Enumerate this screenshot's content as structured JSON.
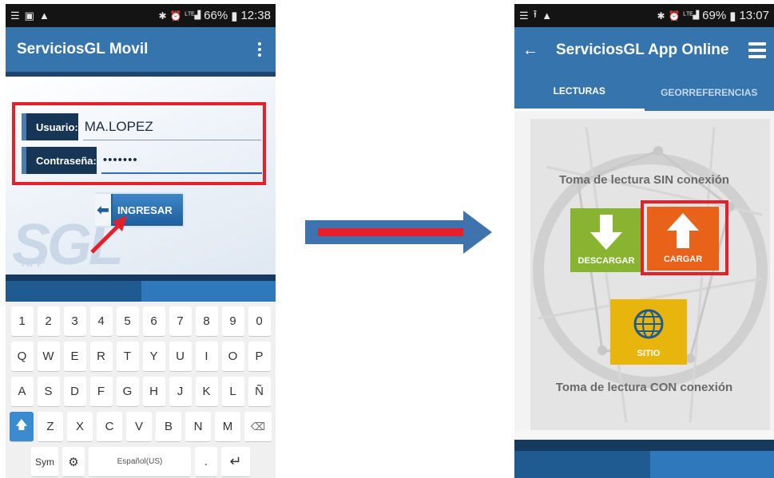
{
  "left_phone": {
    "status": {
      "battery": "66%",
      "time": "12:38"
    },
    "app_title": "ServiciosGL Movil",
    "login": {
      "user_label": "Usuario:",
      "user_value": "MA.LOPEZ",
      "password_label": "Contraseña:",
      "password_value": "•••••••",
      "submit_label": "INGRESAR"
    },
    "keyboard": {
      "row1": [
        "1",
        "2",
        "3",
        "4",
        "5",
        "6",
        "7",
        "8",
        "9",
        "0"
      ],
      "row2": [
        "Q",
        "W",
        "E",
        "R",
        "T",
        "Y",
        "U",
        "I",
        "O",
        "P"
      ],
      "row3": [
        "A",
        "S",
        "D",
        "F",
        "G",
        "H",
        "J",
        "K",
        "L",
        "Ñ"
      ],
      "row4": [
        "Z",
        "X",
        "C",
        "V",
        "B",
        "N",
        "M"
      ],
      "sym_label": "Sym",
      "space_label": "Español(US)",
      "dot_label": "."
    }
  },
  "right_phone": {
    "status": {
      "battery": "69%",
      "time": "13:07"
    },
    "app_title": "ServiciosGL App Online",
    "tabs": [
      "LECTURAS",
      "GEORREFERENCIAS"
    ],
    "offline_label": "Toma de lectura SIN conexión",
    "online_label": "Toma de lectura CON conexión",
    "buttons": {
      "descargar": "DESCARGAR",
      "cargar": "CARGAR",
      "sitio": "SITIO"
    }
  },
  "colors": {
    "app_blue": "#3574ad",
    "highlight_red": "#e5202a",
    "descargar_green": "#88b431",
    "cargar_orange": "#e8621a",
    "sitio_yellow": "#e7b50b"
  }
}
